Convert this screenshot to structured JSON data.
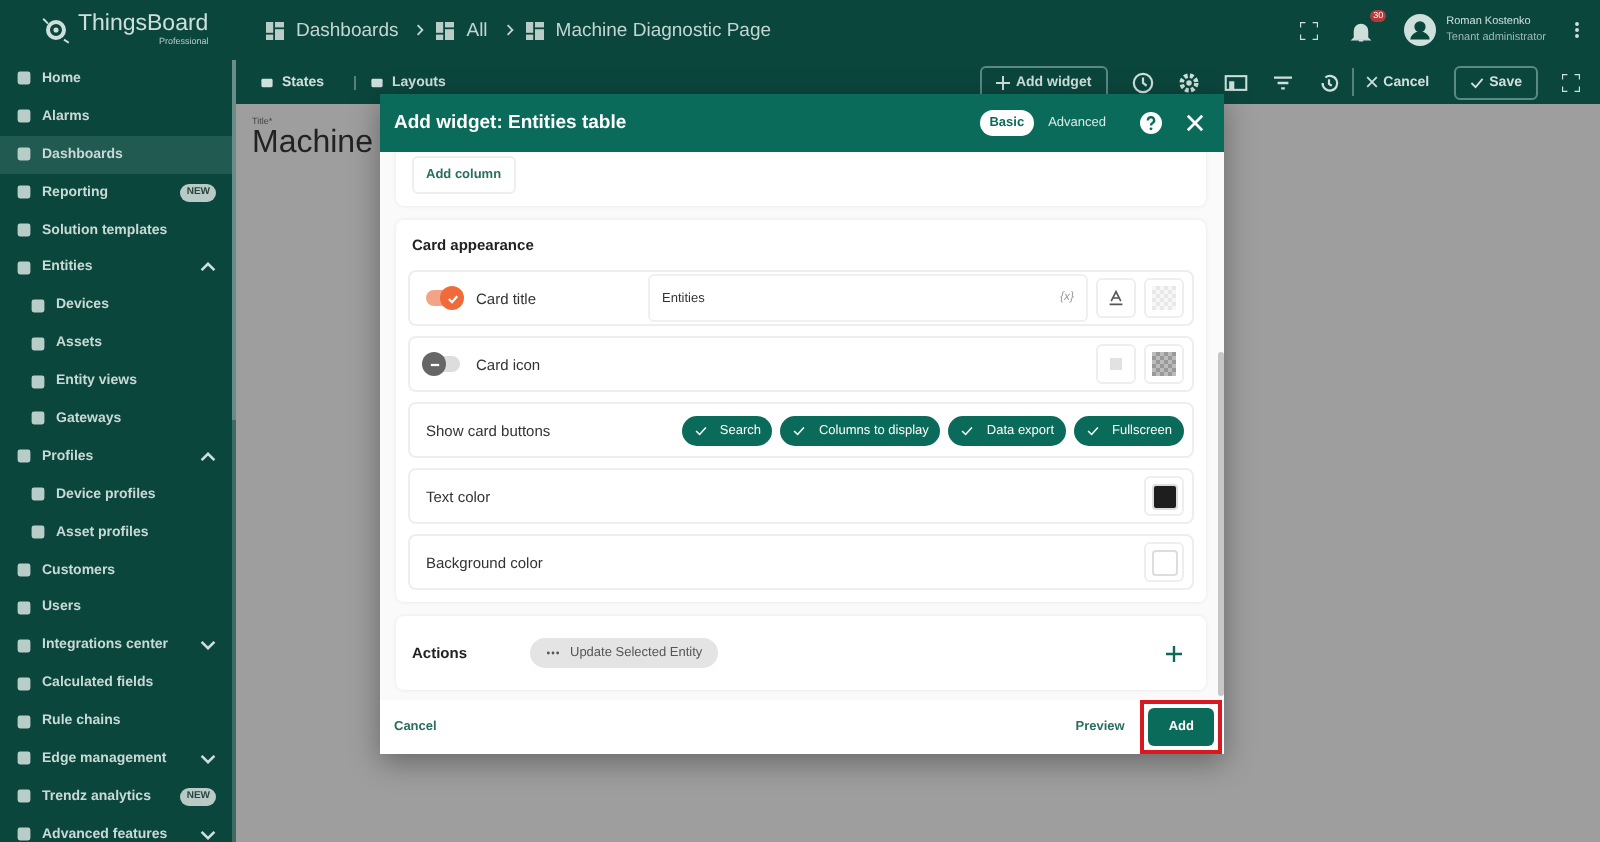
{
  "header": {
    "logo": {
      "name": "ThingsBoard",
      "subtitle": "Professional"
    },
    "breadcrumbs": [
      "Dashboards",
      "All",
      "Machine Diagnostic Page"
    ],
    "notifications": "30",
    "user": {
      "name": "Roman Kostenko",
      "role": "Tenant administrator"
    }
  },
  "toolbar": {
    "left": [
      "States",
      "Layouts"
    ],
    "add_widget": "Add widget",
    "cancel": "Cancel",
    "save": "Save"
  },
  "sidebar": {
    "items": [
      {
        "label": "Home",
        "selected": false
      },
      {
        "label": "Alarms",
        "selected": false
      },
      {
        "label": "Dashboards",
        "selected": true
      },
      {
        "label": "Reporting",
        "selected": false,
        "badge": "NEW"
      },
      {
        "label": "Solution templates",
        "selected": false
      },
      {
        "label": "Entities",
        "selected": false,
        "expanded": true,
        "children": [
          {
            "label": "Devices",
            "selected": false
          },
          {
            "label": "Assets",
            "selected": false
          },
          {
            "label": "Entity views",
            "selected": false
          },
          {
            "label": "Gateways",
            "selected": false
          }
        ]
      },
      {
        "label": "Profiles",
        "selected": false,
        "expanded": true,
        "children": [
          {
            "label": "Device profiles",
            "selected": false
          },
          {
            "label": "Asset profiles",
            "selected": false
          }
        ]
      },
      {
        "label": "Customers",
        "selected": false
      },
      {
        "label": "Users",
        "selected": false
      },
      {
        "label": "Integrations center",
        "selected": false,
        "expanded": false
      },
      {
        "label": "Calculated fields",
        "selected": false
      },
      {
        "label": "Rule chains",
        "selected": false
      },
      {
        "label": "Edge management",
        "selected": false,
        "expanded": false
      },
      {
        "label": "Trendz analytics",
        "selected": false,
        "badge": "NEW"
      },
      {
        "label": "Advanced features",
        "selected": false,
        "expanded": false
      }
    ]
  },
  "canvas": {
    "title_label": "Title*",
    "title": "Machine"
  },
  "dialog": {
    "title": "Add widget:",
    "widget": "Entities table",
    "modes": [
      {
        "label": "Basic",
        "selected": true
      },
      {
        "label": "Advanced",
        "selected": false
      }
    ],
    "column_button": "Add column",
    "section": "Card appearance",
    "rows": [
      {
        "kind": "toggle",
        "label": "Card title",
        "on": true,
        "value": "Entities",
        "suffix": "{x}"
      },
      {
        "kind": "toggle",
        "label": "Card icon",
        "on": false
      },
      {
        "kind": "chips",
        "label": "Show card buttons",
        "chips": [
          {
            "label": "Search",
            "checked": true
          },
          {
            "label": "Columns to display",
            "checked": true
          },
          {
            "label": "Data export",
            "checked": true
          },
          {
            "label": "Fullscreen",
            "checked": true
          }
        ]
      },
      {
        "kind": "color",
        "label": "Text color",
        "color": "#1e1e1e"
      },
      {
        "kind": "color",
        "label": "Background color",
        "color": "#ffffff"
      }
    ],
    "actions": {
      "label": "Actions",
      "chip": "Update Selected Entity"
    },
    "footer": {
      "cancel": "Cancel",
      "preview": "Preview",
      "add": "Add",
      "add_highlighted": true
    }
  }
}
